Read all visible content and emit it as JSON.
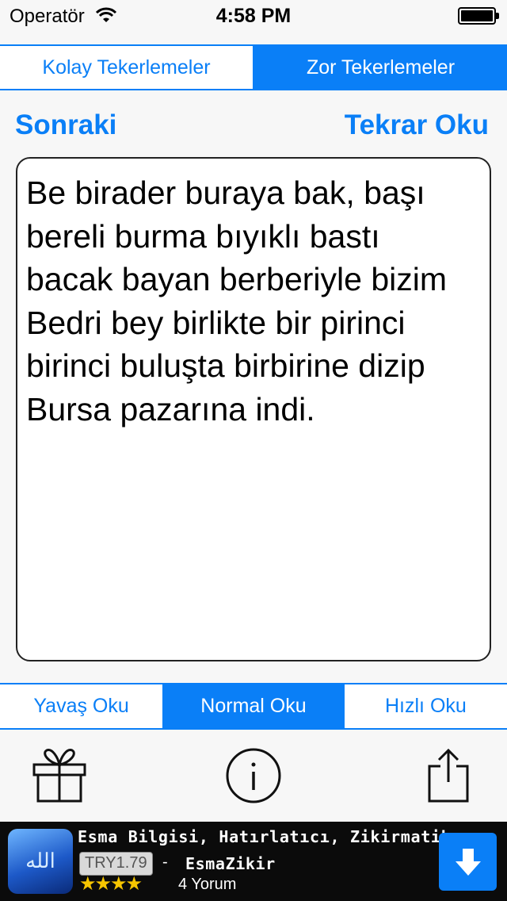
{
  "status": {
    "carrier": "Operatör",
    "time": "4:58 PM"
  },
  "top_tabs": [
    {
      "label": "Kolay Tekerlemeler",
      "selected": false
    },
    {
      "label": "Zor Tekerlemeler",
      "selected": true
    }
  ],
  "actions": {
    "next": "Sonraki",
    "repeat": "Tekrar Oku"
  },
  "tongue_twister_text": "Be birader buraya bak, başı bereli burma bıyıklı bastı bacak bayan berberiyle bizim Bedri bey birlikte bir pirinci birinci buluşta birbirine dizip Bursa pazarına indi.",
  "speed_tabs": [
    {
      "label": "Yavaş Oku",
      "selected": false
    },
    {
      "label": "Normal Oku",
      "selected": true
    },
    {
      "label": "Hızlı Oku",
      "selected": false
    }
  ],
  "toolbar_icons": [
    "gift-icon",
    "info-icon",
    "share-icon"
  ],
  "ad": {
    "title": "Esma Bilgisi, Hatırlatıcı, Zikirmatik",
    "price": "TRY1.79",
    "separator": "-",
    "app_name": "EsmaZikir",
    "stars": "★★★★",
    "rating": 4,
    "reviews": "4 Yorum",
    "icon_glyph": "الله"
  },
  "colors": {
    "accent": "#0a7ff7",
    "background": "#f7f7f7",
    "ad_background": "#0b0b0b",
    "star": "#f6c500"
  }
}
